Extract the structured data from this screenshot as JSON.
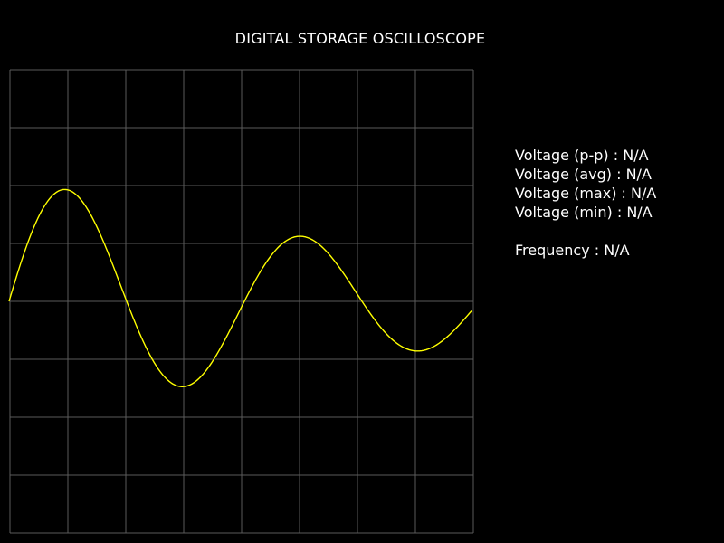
{
  "window": {
    "title": "DIGITAL STORAGE OSCILLOSCOPE"
  },
  "measurements": {
    "vpp": "Voltage (p-p) : N/A",
    "vavg": "Voltage (avg) : N/A",
    "vmax": "Voltage (max) : N/A",
    "vmin": "Voltage (min) : N/A",
    "frequency": "Frequency : N/A"
  },
  "colors": {
    "background": "#000000",
    "grid": "#5a5a5a",
    "trace": "#ffff00",
    "text": "#ffffff"
  }
}
